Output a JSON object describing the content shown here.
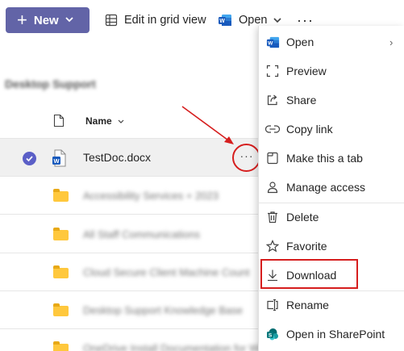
{
  "toolbar": {
    "new_label": "New",
    "grid_label": "Edit in grid view",
    "open_label": "Open",
    "more_label": "···"
  },
  "library": {
    "title": "Desktop Support",
    "name_header": "Name"
  },
  "rows": [
    {
      "name": "TestDoc.docx",
      "type": "word",
      "selected": true
    },
    {
      "name": "Accessibility Services + 2023",
      "type": "folder"
    },
    {
      "name": "All Staff Communications",
      "type": "folder"
    },
    {
      "name": "Cloud Secure Client Machine Count",
      "type": "folder"
    },
    {
      "name": "Desktop Support Knowledge Base",
      "type": "folder"
    },
    {
      "name": "OneDrive Install Documentation for Win",
      "type": "folder"
    }
  ],
  "row_more_label": "···",
  "menu": {
    "items": [
      {
        "label": "Open",
        "icon": "word-icon",
        "has_submenu": true
      },
      {
        "label": "Preview",
        "icon": "preview-icon"
      },
      {
        "label": "Share",
        "icon": "share-icon"
      },
      {
        "label": "Copy link",
        "icon": "link-icon"
      },
      {
        "label": "Make this a tab",
        "icon": "tab-icon"
      },
      {
        "label": "Manage access",
        "icon": "person-icon"
      },
      {
        "label": "Delete",
        "icon": "trash-icon"
      },
      {
        "label": "Favorite",
        "icon": "star-icon"
      },
      {
        "label": "Download",
        "icon": "download-icon"
      },
      {
        "label": "Rename",
        "icon": "rename-icon"
      },
      {
        "label": "Open in SharePoint",
        "icon": "sharepoint-icon"
      }
    ],
    "submenu_glyph": "›"
  },
  "colors": {
    "accent": "#6264a7",
    "annotation": "#d61e1e",
    "folder": "#ffc83d",
    "word_blue": "#185abd"
  }
}
